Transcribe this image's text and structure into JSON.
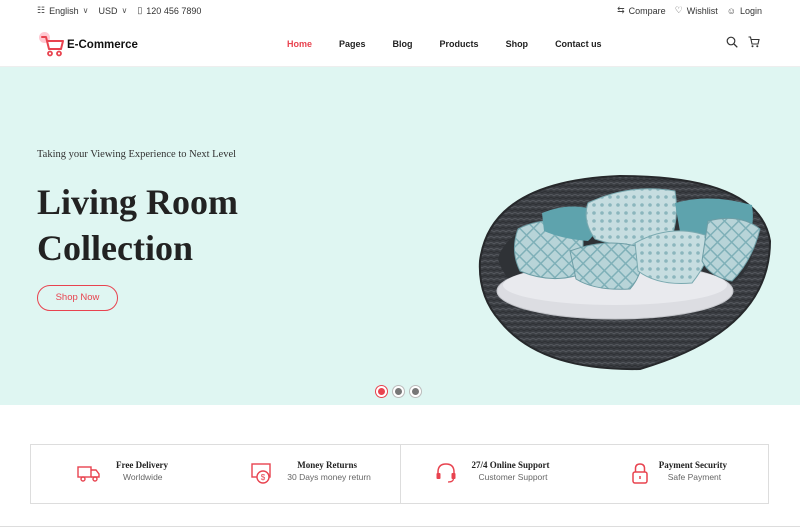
{
  "topbar": {
    "language": "English",
    "currency": "USD",
    "phone": "120 456 7890",
    "compare": "Compare",
    "wishlist": "Wishlist",
    "login": "Login"
  },
  "header": {
    "logo_text": "E-Commerce",
    "nav": [
      {
        "label": "Home",
        "active": true
      },
      {
        "label": "Pages"
      },
      {
        "label": "Blog"
      },
      {
        "label": "Products"
      },
      {
        "label": "Shop"
      },
      {
        "label": "Contact us"
      }
    ],
    "icons": [
      "search-icon",
      "cart-icon"
    ]
  },
  "hero": {
    "kicker": "Taking your Viewing Experience to Next Level",
    "title": "Living Room Collection",
    "button": "Shop Now",
    "slides": 3,
    "active_slide": 1,
    "background": "#dff6f2",
    "accent": "#e8434f"
  },
  "features": [
    {
      "icon": "truck-icon",
      "title": "Free Delivery",
      "subtitle": "Worldwide"
    },
    {
      "icon": "money-return-icon",
      "title": "Money Returns",
      "subtitle": "30 Days money return"
    },
    {
      "icon": "headset-icon",
      "title": "27/4 Online Support",
      "subtitle": "Customer Support"
    },
    {
      "icon": "lock-icon",
      "title": "Payment Security",
      "subtitle": "Safe Payment"
    }
  ]
}
